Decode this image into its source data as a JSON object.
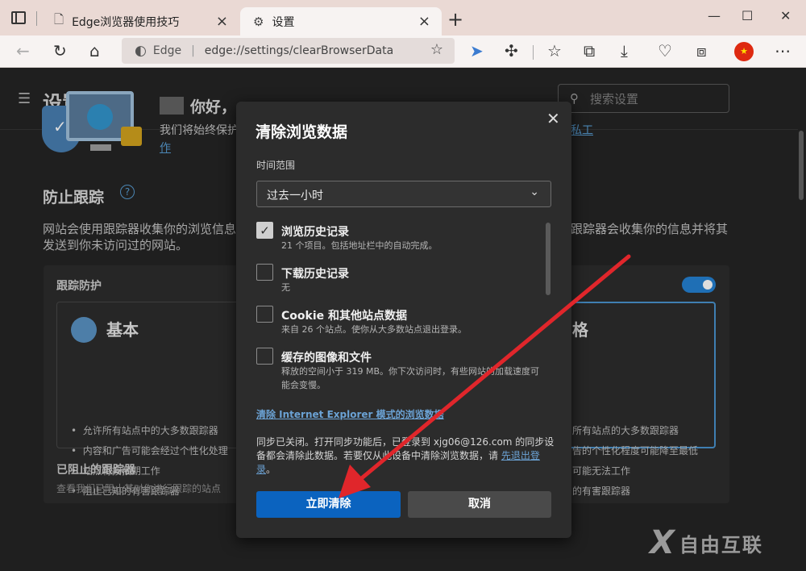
{
  "browser": {
    "tabs": [
      {
        "label": "Edge浏览器使用技巧",
        "icon": "page-icon"
      },
      {
        "label": "设置",
        "icon": "gear-icon"
      }
    ],
    "new_tab": "+",
    "window": {
      "minimize": "—",
      "maximize": "☐",
      "close": "✕"
    },
    "address": {
      "site": "Edge",
      "url": "edge://settings/clearBrowserData"
    }
  },
  "settings": {
    "title": "设置",
    "search_placeholder": "搜索设置",
    "greeting": "你好，",
    "greeting_sub": "我们将始终保护",
    "greeting_link_tail1": "私工",
    "greeting_link_tail2": "作",
    "tracking_title": "防止跟踪",
    "tracking_desc_l1": "网站会使用跟踪器收集你的浏览信息。",
    "tracking_desc_l2": "发送到你未访问过的网站。",
    "tracking_desc_r": "跟踪器会收集你的信息并将其",
    "panel_title": "跟踪防护",
    "basic": {
      "title": "基本",
      "items": [
        "允许所有站点中的大多数跟踪器",
        "内容和广告可能会经过个性化处理",
        "站点将按预期工作",
        "阻止已知的有害跟踪器"
      ]
    },
    "strict": {
      "title": "格",
      "items": [
        "所有站点的大多数跟踪器",
        "告的个性化程度可能降至最低",
        "可能无法工作",
        "的有害跟踪器"
      ]
    },
    "blocked_title": "已阻止的跟踪器",
    "blocked_sub": "查看我们已阻止其对你进行跟踪的站点"
  },
  "dialog": {
    "title": "清除浏览数据",
    "time_range_label": "时间范围",
    "time_range_value": "过去一小时",
    "options": [
      {
        "label": "浏览历史记录",
        "desc": "21 个项目。包括地址栏中的自动完成。",
        "checked": true
      },
      {
        "label": "下载历史记录",
        "desc": "无",
        "checked": false
      },
      {
        "label": "Cookie 和其他站点数据",
        "desc": "来自 26 个站点。使你从大多数站点退出登录。",
        "checked": false
      },
      {
        "label": "缓存的图像和文件",
        "desc": "释放的空间小于 319 MB。你下次访问时，有些网站的加载速度可能会变慢。",
        "checked": false
      }
    ],
    "ie_link": "清除 Internet Explorer 模式的浏览数据",
    "sync_note_text": "同步已关闭。打开同步功能后，已登录到 xjg06@126.com 的同步设备都会清除此数据。若要仅从此设备中清除浏览数据，请 ",
    "sync_note_link": "先退出登录",
    "sync_note_end": "。",
    "clear_button": "立即清除",
    "cancel_button": "取消"
  },
  "watermark": {
    "mark": "X",
    "text": "自由互联"
  },
  "colors": {
    "accent": "#0b63bf",
    "arrow": "#e0262b",
    "toggle": "#1f6fb5"
  }
}
